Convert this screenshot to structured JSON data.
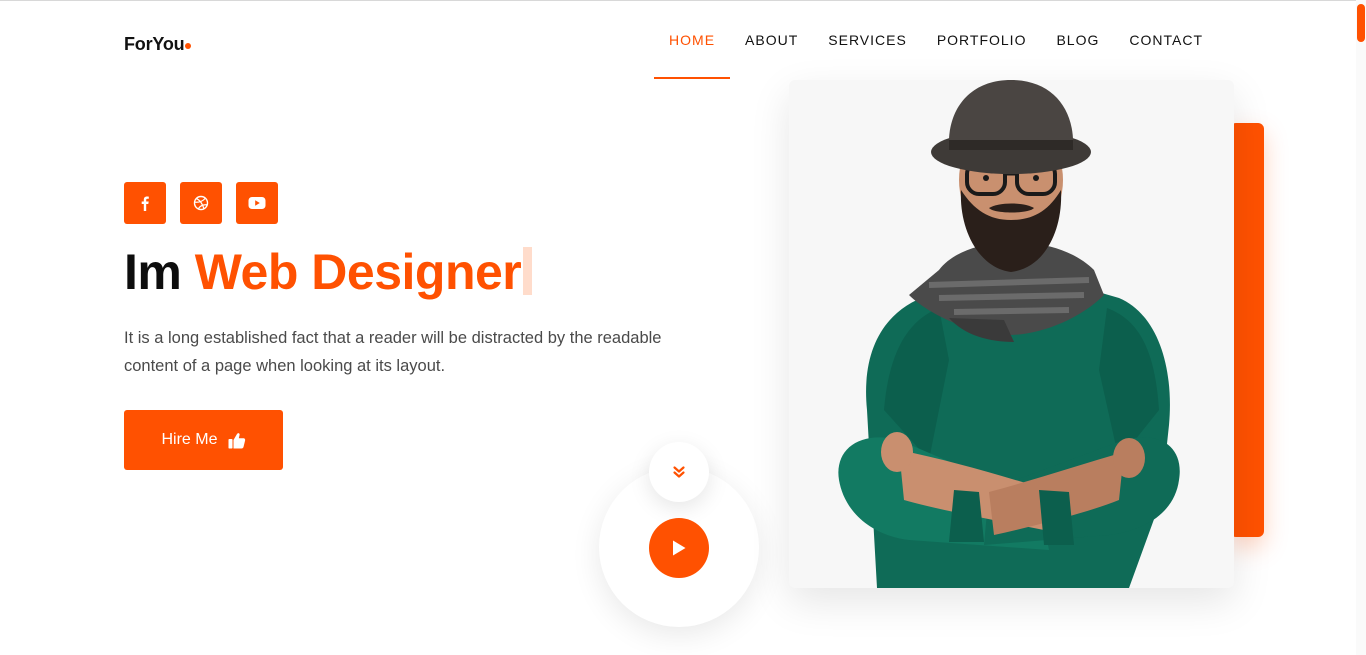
{
  "brand": {
    "name": "ForYou",
    "accent_color": "#ff5101"
  },
  "nav": {
    "items": [
      {
        "label": "HOME",
        "active": true
      },
      {
        "label": "ABOUT",
        "active": false
      },
      {
        "label": "SERVICES",
        "active": false
      },
      {
        "label": "PORTFOLIO",
        "active": false
      },
      {
        "label": "BLOG",
        "active": false
      },
      {
        "label": "CONTACT",
        "active": false
      }
    ]
  },
  "hero": {
    "socials": [
      "facebook-icon",
      "dribbble-icon",
      "youtube-icon"
    ],
    "headline_prefix": "Im",
    "headline_accent": "Web Designer",
    "description": "It is a long established fact that a reader will be distracted by the readable content of a page when looking at its layout.",
    "hire_button": "Hire Me",
    "hire_icon": "thumbs-up-icon",
    "scroll_icon": "double-chevron-down-icon",
    "play_icon": "play-icon",
    "photo": "man-with-hat-and-glasses-photo"
  }
}
